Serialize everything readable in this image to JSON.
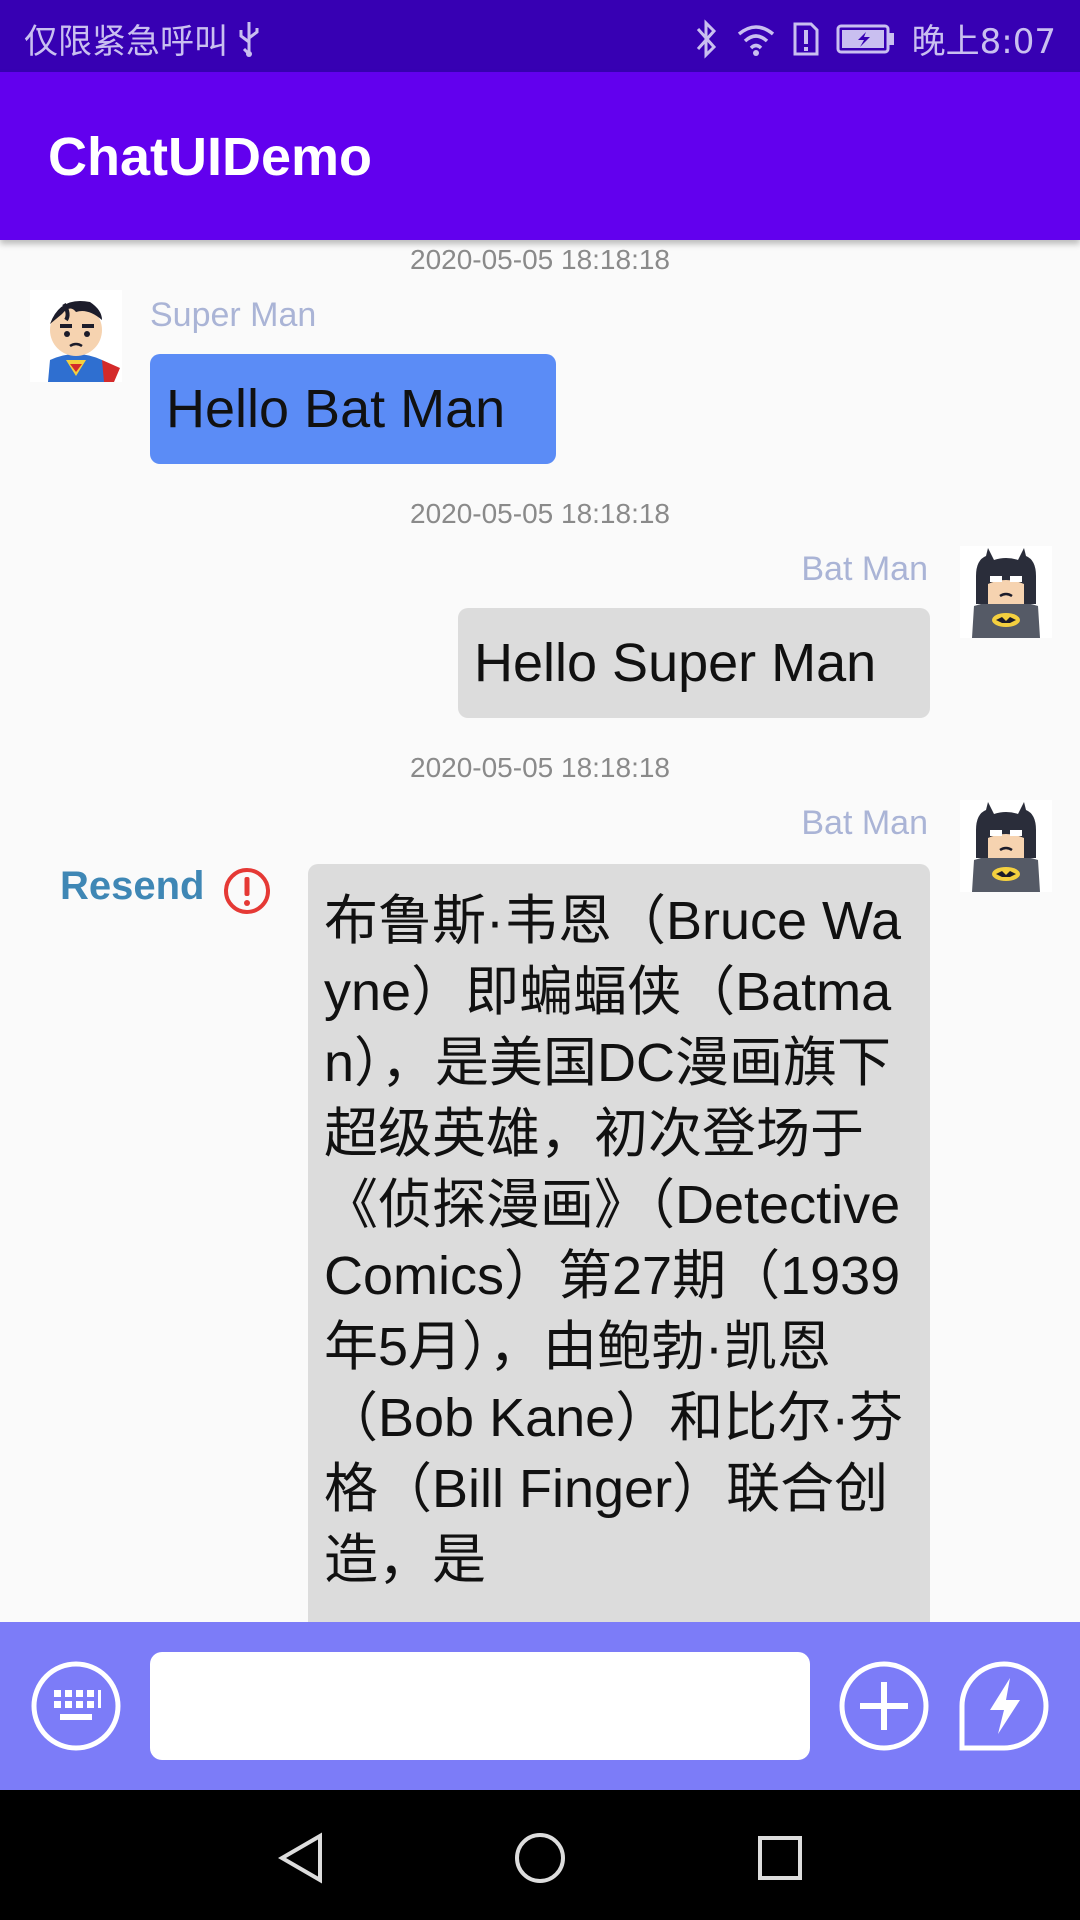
{
  "status_bar": {
    "carrier": "仅限紧急呼叫",
    "time": "晚上8:07"
  },
  "app_bar": {
    "title": "ChatUIDemo"
  },
  "messages": [
    {
      "timestamp": "2020-05-05 18:18:18",
      "sender": "Super Man",
      "side": "left",
      "text": "Hello Bat Man"
    },
    {
      "timestamp": "2020-05-05 18:18:18",
      "sender": "Bat Man",
      "side": "right",
      "text": "Hello Super Man"
    },
    {
      "timestamp": "2020-05-05 18:18:18",
      "sender": "Bat Man",
      "side": "right",
      "text": "布鲁斯·韦恩（Bruce Wayne）即蝙蝠侠（Batman），是美国DC漫画旗下超级英雄，初次登场于《侦探漫画》（Detective Comics）第27期（1939年5月），由鲍勃·凯恩（Bob Kane）和比尔·芬格（Bill Finger）联合创造，是",
      "resend_label": "Resend"
    }
  ],
  "input_bar": {
    "value": "",
    "placeholder": ""
  },
  "icons": {
    "keyboard": "keyboard-icon",
    "add": "add-circle-icon",
    "quick": "lightning-icon",
    "alert": "exclamation-circle-icon"
  },
  "colors": {
    "status_bar": "#3700b3",
    "app_bar": "#6200ee",
    "bubble_left": "#5b8cf6",
    "bubble_right": "#dcdcdc",
    "input_bar": "#7c7cf8",
    "resend": "#3f87b5",
    "alert": "#e53935"
  }
}
